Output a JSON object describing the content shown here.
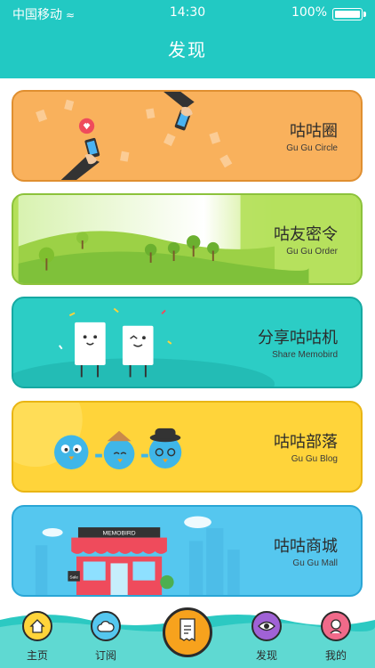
{
  "status_bar": {
    "carrier": "中国移动",
    "time": "14:30",
    "battery": "100%"
  },
  "page_title": "发现",
  "cards": [
    {
      "title": "咕咕圈",
      "subtitle": "Gu Gu Circle",
      "bg": "#f9b15c",
      "border": "#e08f30"
    },
    {
      "title": "咕友密令",
      "subtitle": "Gu Gu Order",
      "bg": "#b4e05a",
      "border": "#8cc23b"
    },
    {
      "title": "分享咕咕机",
      "subtitle": "Share Memobird",
      "bg": "#2ccdc5",
      "border": "#16a9a2"
    },
    {
      "title": "咕咕部落",
      "subtitle": "Gu Gu Blog",
      "bg": "#ffd43a",
      "border": "#e9b514"
    },
    {
      "title": "咕咕商城",
      "subtitle": "Gu Gu Mall",
      "bg": "#55c7ef",
      "border": "#2aa6d6"
    }
  ],
  "shop_sign": "MEMOBIRD",
  "shop_window_sign": "Sale",
  "tabbar": {
    "items": [
      {
        "label": "主页",
        "icon": "home-icon",
        "color": "#ffd43a"
      },
      {
        "label": "订阅",
        "icon": "cloud-icon",
        "color": "#55c7ef"
      },
      {
        "label": "",
        "icon": "receipt-icon",
        "color": "#f7a21d"
      },
      {
        "label": "发现",
        "icon": "eye-icon",
        "color": "#a062d6"
      },
      {
        "label": "我的",
        "icon": "user-icon",
        "color": "#f06a8a"
      }
    ]
  }
}
